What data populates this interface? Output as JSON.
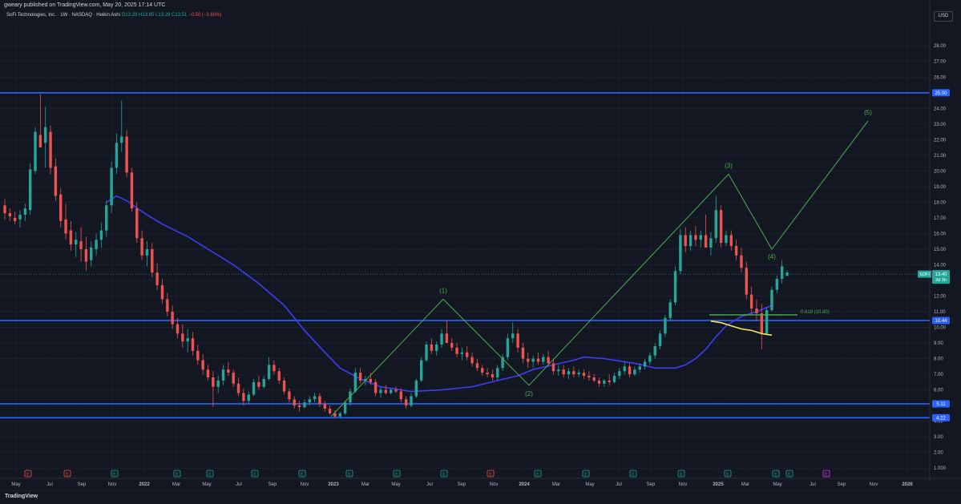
{
  "header": {
    "published": "gweary published on TradingView.com, May 20, 2025 17:14 UTC",
    "symbol": "SoFi Technologies, Inc. · 1W · NASDAQ · Heikin Ashi",
    "o": "O13.29",
    "h": "H13.65",
    "l": "L13.29",
    "c": "C13.51",
    "change": "−0.50 (−3.60%)"
  },
  "currency": "USD",
  "footer": {
    "brand": "TradingView"
  },
  "chart_data": {
    "type": "candlestick",
    "style": "Heikin Ashi",
    "interval": "1W",
    "ylim": [
      0.6,
      29.6
    ],
    "y_ticks": [
      "1.000",
      "2.00",
      "3.00",
      "4.00",
      "5.00",
      "6.00",
      "7.00",
      "8.00",
      "9.00",
      "10.00",
      "11.00",
      "12.00",
      "13.00",
      "14.00",
      "15.00",
      "16.00",
      "17.00",
      "18.00",
      "19.00",
      "20.00",
      "21.00",
      "22.00",
      "23.00",
      "24.00",
      "25.00",
      "26.00",
      "27.00",
      "28.00"
    ],
    "x_ticks": [
      "May",
      "Jul",
      "Sep",
      "Nov",
      "2022",
      "Mar",
      "May",
      "Jul",
      "Sep",
      "Nov",
      "2023",
      "Mar",
      "May",
      "Jul",
      "Sep",
      "Nov",
      "2024",
      "Mar",
      "May",
      "Jul",
      "Sep",
      "Nov",
      "2025",
      "Mar",
      "May",
      "Jul",
      "Sep",
      "Nov",
      "2026"
    ],
    "horizontal_levels": [
      {
        "value": 25.0,
        "label": "25.00"
      },
      {
        "value": 10.44,
        "label": "10.44"
      },
      {
        "value": 5.11,
        "label": "5.11"
      },
      {
        "value": 4.22,
        "label": "4.22"
      }
    ],
    "last_price": {
      "symbol": "SOFI",
      "value": "13.40",
      "countdown": "3d 3h"
    },
    "fib_level": {
      "label": "0.618 (10.80)",
      "value": 10.8
    },
    "wave_labels": [
      {
        "label": "(1)",
        "value": 11.8
      },
      {
        "label": "(2)",
        "value": 6.3
      },
      {
        "label": "(3)",
        "value": 19.8
      },
      {
        "label": "(4)",
        "value": 15.0
      },
      {
        "label": "(5)",
        "value": 23.2
      }
    ],
    "earnings_markers": [
      "E",
      "E",
      "E",
      "E",
      "E",
      "E",
      "E",
      "E",
      "E",
      "E",
      "E",
      "E",
      "E",
      "E",
      "E",
      "E",
      "E",
      "E",
      "E",
      "D"
    ],
    "series": [
      {
        "name": "",
        "type": "candles",
        "ohlc": [
          [
            17.8,
            18.2,
            16.9,
            17.3
          ],
          [
            17.3,
            17.6,
            16.8,
            17.1
          ],
          [
            17.0,
            17.4,
            16.6,
            16.8
          ],
          [
            16.9,
            17.5,
            16.4,
            17.2
          ],
          [
            17.2,
            17.9,
            16.8,
            17.6
          ],
          [
            17.5,
            20.5,
            17.2,
            20.1
          ],
          [
            20.0,
            22.8,
            19.8,
            22.5
          ],
          [
            22.3,
            24.9,
            21.8,
            21.5
          ],
          [
            21.8,
            24.1,
            20.2,
            22.8
          ],
          [
            22.5,
            22.9,
            19.8,
            20.2
          ],
          [
            20.3,
            20.8,
            18.1,
            18.4
          ],
          [
            18.5,
            18.9,
            16.4,
            16.8
          ],
          [
            16.9,
            17.9,
            15.6,
            16.0
          ],
          [
            16.2,
            16.8,
            14.9,
            15.3
          ],
          [
            15.3,
            16.1,
            14.5,
            15.6
          ],
          [
            15.5,
            16.4,
            14.2,
            15.0
          ],
          [
            15.0,
            15.8,
            13.6,
            14.2
          ],
          [
            14.3,
            15.5,
            13.9,
            15.1
          ],
          [
            15.0,
            16.0,
            14.6,
            15.6
          ],
          [
            15.6,
            16.7,
            15.1,
            16.2
          ],
          [
            16.2,
            18.1,
            15.8,
            17.8
          ],
          [
            17.8,
            20.6,
            17.3,
            20.2
          ],
          [
            20.2,
            22.4,
            19.8,
            21.8
          ],
          [
            21.8,
            24.5,
            21.2,
            22.2
          ],
          [
            22.2,
            22.6,
            19.6,
            19.9
          ],
          [
            19.9,
            20.2,
            17.4,
            17.6
          ],
          [
            17.6,
            18.0,
            15.4,
            15.7
          ],
          [
            15.7,
            16.2,
            14.3,
            14.6
          ],
          [
            14.6,
            15.5,
            13.9,
            15.0
          ],
          [
            15.0,
            15.4,
            13.2,
            13.5
          ],
          [
            13.5,
            14.1,
            12.4,
            12.7
          ],
          [
            12.7,
            13.1,
            11.5,
            11.8
          ],
          [
            11.8,
            12.2,
            10.7,
            11.0
          ],
          [
            11.0,
            11.4,
            9.9,
            10.2
          ],
          [
            10.2,
            10.6,
            9.3,
            9.6
          ],
          [
            9.6,
            10.2,
            8.7,
            9.1
          ],
          [
            9.1,
            9.9,
            8.4,
            9.3
          ],
          [
            9.3,
            9.7,
            8.2,
            8.5
          ],
          [
            8.5,
            8.9,
            7.6,
            7.9
          ],
          [
            7.9,
            8.3,
            7.0,
            7.3
          ],
          [
            7.3,
            7.6,
            6.6,
            6.8
          ],
          [
            6.8,
            7.2,
            4.9,
            6.2
          ],
          [
            6.2,
            6.9,
            5.8,
            6.6
          ],
          [
            6.6,
            7.6,
            6.3,
            7.3
          ],
          [
            7.3,
            7.8,
            6.9,
            7.1
          ],
          [
            7.1,
            7.3,
            6.2,
            6.4
          ],
          [
            6.4,
            6.8,
            5.6,
            5.8
          ],
          [
            5.8,
            6.1,
            5.0,
            5.3
          ],
          [
            5.3,
            5.9,
            5.1,
            5.7
          ],
          [
            5.7,
            6.7,
            5.6,
            6.5
          ],
          [
            6.5,
            6.9,
            6.0,
            6.2
          ],
          [
            6.2,
            6.9,
            6.1,
            6.7
          ],
          [
            6.7,
            8.1,
            6.6,
            7.6
          ],
          [
            7.6,
            7.9,
            7.0,
            7.2
          ],
          [
            7.2,
            7.4,
            6.4,
            6.6
          ],
          [
            6.6,
            6.8,
            5.7,
            5.9
          ],
          [
            5.9,
            6.1,
            5.2,
            5.4
          ],
          [
            5.4,
            5.6,
            4.8,
            5.0
          ],
          [
            5.0,
            5.3,
            4.6,
            4.9
          ],
          [
            4.9,
            5.4,
            4.8,
            5.2
          ],
          [
            5.2,
            5.6,
            5.0,
            5.4
          ],
          [
            5.4,
            5.8,
            5.2,
            5.6
          ],
          [
            5.6,
            5.8,
            4.9,
            5.1
          ],
          [
            5.1,
            5.3,
            4.6,
            4.8
          ],
          [
            4.8,
            5.0,
            4.4,
            4.5
          ],
          [
            4.5,
            4.7,
            4.2,
            4.3
          ],
          [
            4.3,
            4.6,
            4.2,
            4.5
          ],
          [
            4.5,
            5.3,
            4.4,
            5.2
          ],
          [
            5.2,
            6.1,
            5.0,
            5.9
          ],
          [
            5.9,
            7.4,
            5.8,
            7.1
          ],
          [
            7.1,
            7.4,
            6.4,
            6.6
          ],
          [
            6.6,
            6.9,
            6.3,
            6.7
          ],
          [
            6.7,
            7.1,
            6.3,
            6.5
          ],
          [
            6.5,
            6.7,
            5.6,
            5.8
          ],
          [
            5.8,
            6.2,
            5.5,
            6.0
          ],
          [
            6.0,
            6.3,
            5.7,
            5.8
          ],
          [
            5.8,
            6.1,
            5.7,
            6.0
          ],
          [
            6.0,
            6.2,
            5.8,
            5.9
          ],
          [
            5.9,
            6.1,
            5.2,
            5.4
          ],
          [
            5.4,
            5.6,
            4.8,
            5.0
          ],
          [
            5.0,
            5.8,
            4.9,
            5.6
          ],
          [
            5.6,
            6.7,
            5.5,
            6.6
          ],
          [
            6.6,
            8.1,
            6.5,
            7.9
          ],
          [
            7.9,
            9.1,
            7.8,
            8.9
          ],
          [
            8.9,
            9.3,
            8.3,
            8.5
          ],
          [
            8.5,
            9.1,
            8.2,
            8.9
          ],
          [
            8.9,
            9.9,
            8.7,
            9.6
          ],
          [
            9.6,
            10.4,
            9.3,
            9.0
          ],
          [
            9.0,
            9.3,
            8.5,
            8.7
          ],
          [
            8.7,
            9.0,
            8.1,
            8.3
          ],
          [
            8.3,
            8.7,
            7.9,
            8.4
          ],
          [
            8.4,
            8.8,
            7.9,
            8.1
          ],
          [
            8.1,
            8.4,
            7.5,
            7.7
          ],
          [
            7.7,
            8.0,
            7.2,
            7.4
          ],
          [
            7.4,
            7.6,
            6.9,
            7.1
          ],
          [
            7.1,
            7.4,
            6.8,
            7.0
          ],
          [
            7.0,
            7.3,
            6.6,
            6.8
          ],
          [
            6.8,
            7.6,
            6.6,
            7.4
          ],
          [
            7.4,
            8.3,
            7.2,
            8.1
          ],
          [
            8.1,
            9.6,
            7.9,
            9.3
          ],
          [
            9.3,
            10.3,
            9.0,
            9.6
          ],
          [
            9.6,
            9.9,
            8.4,
            8.7
          ],
          [
            8.7,
            9.0,
            7.7,
            8.0
          ],
          [
            8.0,
            8.4,
            7.4,
            7.8
          ],
          [
            7.8,
            8.2,
            7.4,
            8.0
          ],
          [
            8.0,
            8.4,
            7.6,
            7.8
          ],
          [
            7.8,
            8.3,
            7.6,
            8.1
          ],
          [
            8.1,
            8.5,
            7.5,
            7.7
          ],
          [
            7.7,
            8.0,
            7.0,
            7.2
          ],
          [
            7.2,
            7.6,
            6.9,
            7.3
          ],
          [
            7.3,
            7.6,
            6.8,
            7.0
          ],
          [
            7.0,
            7.4,
            6.7,
            7.2
          ],
          [
            7.2,
            7.5,
            6.8,
            7.0
          ],
          [
            7.0,
            7.3,
            6.8,
            7.1
          ],
          [
            7.1,
            7.3,
            6.7,
            6.9
          ],
          [
            6.9,
            7.2,
            6.6,
            6.8
          ],
          [
            6.8,
            7.0,
            6.5,
            6.6
          ],
          [
            6.6,
            6.8,
            6.2,
            6.4
          ],
          [
            6.4,
            6.7,
            6.2,
            6.6
          ],
          [
            6.6,
            7.0,
            6.3,
            6.5
          ],
          [
            6.5,
            7.1,
            6.4,
            6.9
          ],
          [
            6.9,
            7.4,
            6.7,
            7.2
          ],
          [
            7.2,
            7.8,
            7.0,
            7.5
          ],
          [
            7.5,
            7.7,
            6.8,
            7.0
          ],
          [
            7.0,
            7.5,
            6.9,
            7.3
          ],
          [
            7.3,
            7.7,
            7.1,
            7.5
          ],
          [
            7.5,
            8.0,
            7.3,
            7.8
          ],
          [
            7.8,
            8.4,
            7.6,
            8.2
          ],
          [
            8.2,
            9.0,
            8.0,
            8.8
          ],
          [
            8.8,
            9.8,
            8.6,
            9.6
          ],
          [
            9.6,
            10.8,
            9.4,
            10.6
          ],
          [
            10.6,
            11.8,
            10.4,
            11.6
          ],
          [
            11.6,
            13.9,
            11.4,
            13.6
          ],
          [
            13.6,
            16.3,
            13.4,
            15.9
          ],
          [
            15.9,
            16.4,
            14.8,
            15.2
          ],
          [
            15.2,
            16.2,
            14.9,
            15.9
          ],
          [
            15.9,
            16.5,
            15.2,
            15.6
          ],
          [
            15.6,
            16.2,
            15.1,
            15.9
          ],
          [
            15.9,
            17.2,
            15.6,
            15.1
          ],
          [
            15.1,
            16.1,
            14.6,
            15.7
          ],
          [
            15.7,
            18.4,
            15.4,
            17.5
          ],
          [
            17.5,
            17.8,
            15.1,
            15.4
          ],
          [
            15.4,
            16.2,
            15.2,
            15.9
          ],
          [
            15.9,
            16.2,
            14.9,
            15.2
          ],
          [
            15.2,
            15.6,
            14.3,
            14.6
          ],
          [
            14.6,
            15.1,
            13.5,
            13.8
          ],
          [
            13.8,
            14.2,
            11.8,
            12.1
          ],
          [
            12.1,
            12.6,
            10.9,
            11.2
          ],
          [
            11.2,
            11.8,
            10.4,
            10.9
          ],
          [
            10.9,
            11.5,
            8.6,
            9.6
          ],
          [
            9.6,
            11.3,
            9.5,
            11.1
          ],
          [
            11.1,
            12.6,
            11.0,
            12.4
          ],
          [
            12.4,
            13.3,
            12.2,
            13.1
          ],
          [
            13.1,
            14.3,
            12.8,
            13.9
          ],
          [
            13.29,
            13.65,
            13.29,
            13.51
          ]
        ]
      },
      {
        "name": "",
        "type": "line",
        "color": "#3d3df5",
        "values": [
          [
            18.0,
            20
          ],
          [
            18.4,
            22
          ],
          [
            18.1,
            24
          ],
          [
            17.4,
            27
          ],
          [
            16.6,
            31
          ],
          [
            15.8,
            36
          ],
          [
            15.0,
            40
          ],
          [
            14.0,
            45
          ],
          [
            12.8,
            50
          ],
          [
            11.4,
            55
          ],
          [
            9.8,
            59
          ],
          [
            8.4,
            63
          ],
          [
            7.4,
            66
          ],
          [
            6.7,
            70
          ],
          [
            6.2,
            74
          ],
          [
            5.9,
            80
          ],
          [
            6.0,
            86
          ],
          [
            6.2,
            92
          ],
          [
            6.6,
            97
          ],
          [
            6.9,
            101
          ],
          [
            7.3,
            104
          ],
          [
            7.6,
            108
          ],
          [
            7.9,
            112
          ],
          [
            8.1,
            114
          ],
          [
            8.0,
            118
          ],
          [
            7.7,
            124
          ],
          [
            7.4,
            128
          ],
          [
            7.4,
            132
          ],
          [
            7.6,
            134
          ],
          [
            8.0,
            136
          ],
          [
            8.6,
            138
          ],
          [
            9.4,
            140
          ],
          [
            10.1,
            142
          ],
          [
            10.7,
            145
          ],
          [
            11.0,
            148
          ],
          [
            11.4,
            151
          ]
        ]
      },
      {
        "name": "",
        "type": "line",
        "color": "#f5e663",
        "values": [
          [
            10.4,
            139
          ],
          [
            10.3,
            141
          ],
          [
            10.1,
            143
          ],
          [
            9.9,
            145
          ],
          [
            9.8,
            147
          ],
          [
            9.6,
            149
          ],
          [
            9.5,
            151
          ]
        ]
      }
    ]
  }
}
